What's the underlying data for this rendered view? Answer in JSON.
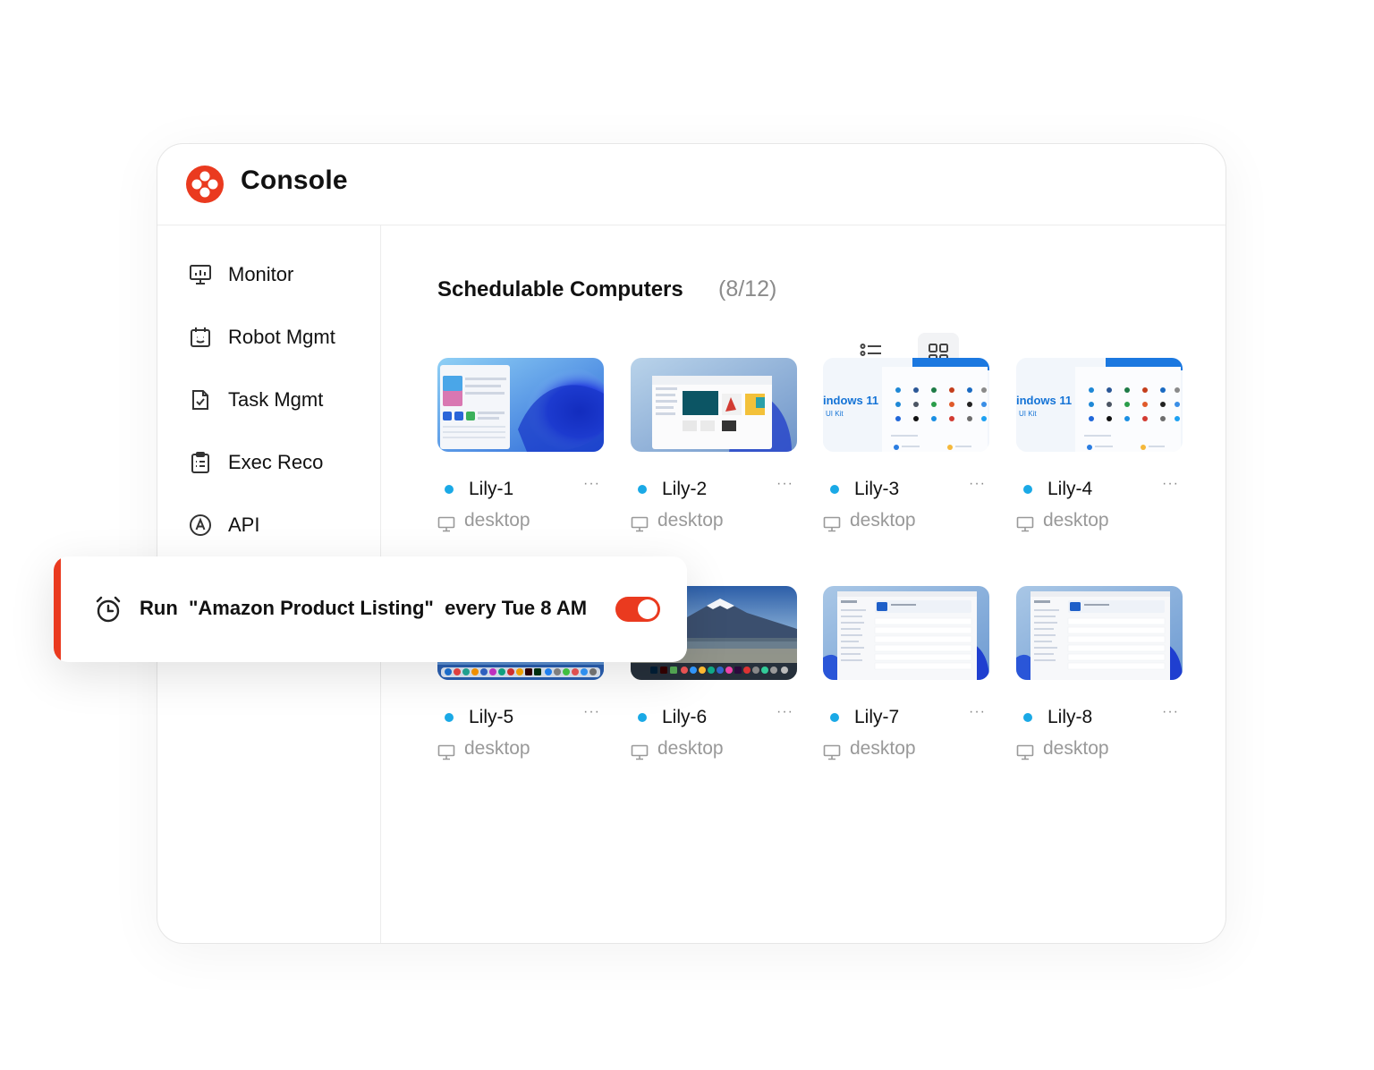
{
  "app": {
    "title": "Console",
    "accent": "#ea3a1f"
  },
  "sidebar": {
    "items": [
      {
        "label": "Monitor",
        "icon": "monitor-chart-icon"
      },
      {
        "label": "Robot Mgmt",
        "icon": "robot-icon"
      },
      {
        "label": "Task Mgmt",
        "icon": "task-file-icon"
      },
      {
        "label": "Exec Reco",
        "icon": "clipboard-icon"
      },
      {
        "label": "API",
        "icon": "api-circle-icon"
      }
    ]
  },
  "main": {
    "title": "Schedulable Computers",
    "count": "(8/12)",
    "view_modes": {
      "list_icon": "list-view-icon",
      "grid_icon": "grid-view-icon",
      "active": "grid"
    },
    "computers": [
      {
        "name": "Lily-1",
        "type": "desktop",
        "status_color": "#1aa9e6",
        "thumb": "windows-bloom-blue"
      },
      {
        "name": "Lily-2",
        "type": "desktop",
        "status_color": "#1aa9e6",
        "thumb": "windows-explorer"
      },
      {
        "name": "Lily-3",
        "type": "desktop",
        "status_color": "#1aa9e6",
        "thumb": "windows-11-ui-kit"
      },
      {
        "name": "Lily-4",
        "type": "desktop",
        "status_color": "#1aa9e6",
        "thumb": "windows-11-ui-kit"
      },
      {
        "name": "Lily-5",
        "type": "desktop",
        "status_color": "#1aa9e6",
        "thumb": "mac-desktop"
      },
      {
        "name": "Lily-6",
        "type": "desktop",
        "status_color": "#1aa9e6",
        "thumb": "mac-mountain"
      },
      {
        "name": "Lily-7",
        "type": "desktop",
        "status_color": "#1aa9e6",
        "thumb": "windows-settings"
      },
      {
        "name": "Lily-8",
        "type": "desktop",
        "status_color": "#1aa9e6",
        "thumb": "windows-settings"
      }
    ],
    "windows_kit_text": "indows 11",
    "windows_kit_sub": "UI Kit",
    "more_glyph": "···"
  },
  "toast": {
    "text": "Run  \"Amazon Product Listing\"  every Tue 8 AM",
    "toggle_on": true,
    "icon": "alarm-clock-icon"
  }
}
